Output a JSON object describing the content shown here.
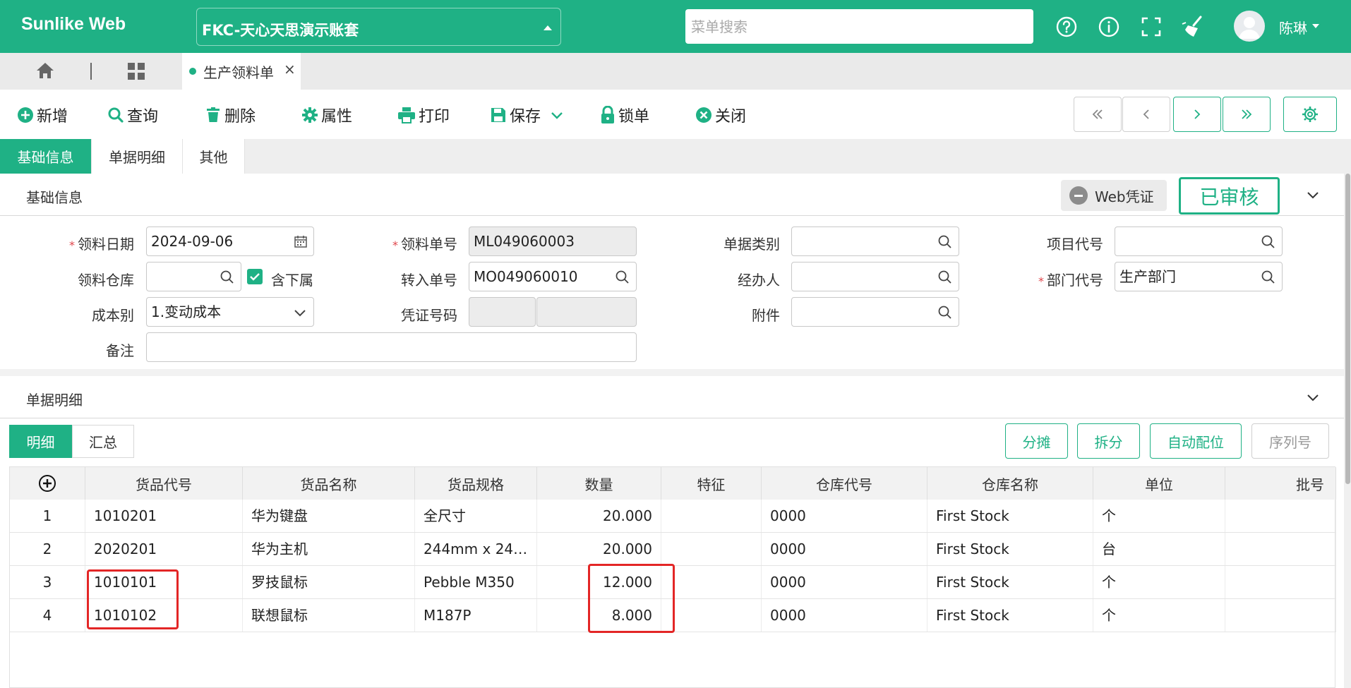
{
  "header": {
    "brand": "Sunlike Web",
    "account": "FKC-天心天思演示账套",
    "search_placeholder": "菜单搜索",
    "user_name": "陈琳"
  },
  "tabs": {
    "current_page": "生产领料单",
    "close": "×"
  },
  "toolbar": {
    "add": "新增",
    "query": "查询",
    "delete": "删除",
    "properties": "属性",
    "print": "打印",
    "save": "保存",
    "lock": "锁单",
    "close": "关闭"
  },
  "form_tabs": [
    "基础信息",
    "单据明细",
    "其他"
  ],
  "basic": {
    "title": "基础信息",
    "web_voucher": "Web凭证",
    "status_stamp": "已审核",
    "labels": {
      "date": "领料日期",
      "order_no": "领料单号",
      "doc_type": "单据类别",
      "project_code": "项目代号",
      "warehouse": "领料仓库",
      "include_sub": "含下属",
      "transfer_no": "转入单号",
      "handler": "经办人",
      "dept_code": "部门代号",
      "cost_type": "成本别",
      "voucher_no": "凭证号码",
      "attachment": "附件",
      "remark": "备注"
    },
    "values": {
      "date": "2024-09-06",
      "order_no": "ML049060003",
      "transfer_no": "MO049060010",
      "dept_code": "生产部门",
      "cost_type": "1.变动成本"
    }
  },
  "detail": {
    "title": "单据明细",
    "subtabs": [
      "明细",
      "汇总"
    ],
    "actions": [
      "分摊",
      "拆分",
      "自动配位",
      "序列号"
    ],
    "columns": [
      "货品代号",
      "货品名称",
      "货品规格",
      "数量",
      "特征",
      "仓库代号",
      "仓库名称",
      "单位",
      "批号"
    ],
    "rows": [
      {
        "no": "1",
        "code": "1010201",
        "name": "华为键盘",
        "spec": "全尺寸",
        "qty": "20.000",
        "feature": "",
        "wh_code": "0000",
        "wh_name": "First Stock",
        "unit": "个",
        "batch": ""
      },
      {
        "no": "2",
        "code": "2020201",
        "name": "华为主机",
        "spec": "244mm x 244…",
        "qty": "20.000",
        "feature": "",
        "wh_code": "0000",
        "wh_name": "First Stock",
        "unit": "台",
        "batch": ""
      },
      {
        "no": "3",
        "code": "1010101",
        "name": "罗技鼠标",
        "spec": "Pebble M350",
        "qty": "12.000",
        "feature": "",
        "wh_code": "0000",
        "wh_name": "First Stock",
        "unit": "个",
        "batch": ""
      },
      {
        "no": "4",
        "code": "1010102",
        "name": "联想鼠标",
        "spec": "M187P",
        "qty": "8.000",
        "feature": "",
        "wh_code": "0000",
        "wh_name": "First Stock",
        "unit": "个",
        "batch": ""
      }
    ]
  },
  "colors": {
    "primary": "#1fb185",
    "highlight": "#e32626",
    "required": "#e0474c"
  }
}
